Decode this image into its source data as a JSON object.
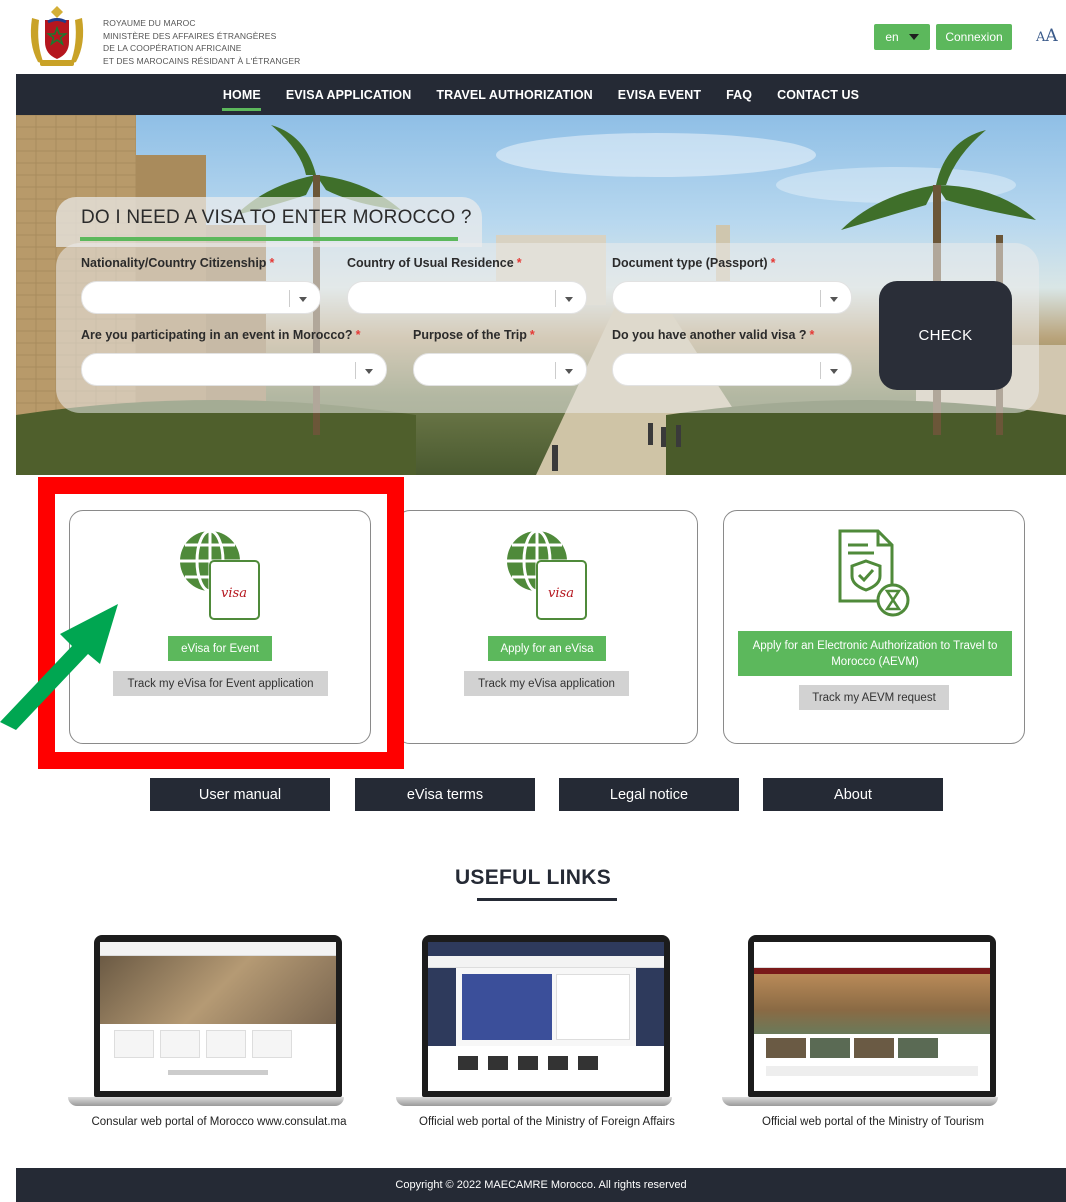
{
  "header": {
    "ministry_line1": "ROYAUME DU MAROC",
    "ministry_line2": "MINISTÈRE DES AFFAIRES ÉTRANGÈRES",
    "ministry_line3": "DE LA COOPÉRATION AFRICAINE",
    "ministry_line4": "ET DES MAROCAINS RÉSIDANT À L'ÉTRANGER",
    "language": "en",
    "login_label": "Connexion",
    "font_toggle_small": "A",
    "font_toggle_big": "A"
  },
  "nav": {
    "items": [
      "HOME",
      "EVISA APPLICATION",
      "TRAVEL AUTHORIZATION",
      "EVISA EVENT",
      "FAQ",
      "CONTACT US"
    ],
    "active": "HOME"
  },
  "visa_check": {
    "title": "DO I NEED A VISA TO ENTER MOROCCO ?",
    "required_mark": "*",
    "fields": [
      {
        "label": "Nationality/Country Citizenship",
        "value": ""
      },
      {
        "label": "Country of Usual Residence",
        "value": ""
      },
      {
        "label": "Document type (Passport)",
        "value": ""
      },
      {
        "label": "Are you participating in an event in Morocco?",
        "value": ""
      },
      {
        "label": "Purpose of the Trip",
        "value": ""
      },
      {
        "label": "Do you have another valid visa ?",
        "value": ""
      }
    ],
    "check_label": "CHECK"
  },
  "cards": [
    {
      "icon": "evisa-globe-icon",
      "primary_label": "eVisa for Event",
      "secondary_label": "Track my eVisa for Event application",
      "highlighted": true
    },
    {
      "icon": "evisa-globe-icon",
      "primary_label": "Apply for an eVisa",
      "secondary_label": "Track my eVisa application"
    },
    {
      "icon": "document-shield-hourglass-icon",
      "primary_label": "Apply for an Electronic Authorization to Travel to Morocco (AEVM)",
      "secondary_label": "Track my AEVM request"
    }
  ],
  "icon_text": "visa",
  "info_buttons": [
    "User manual",
    "eVisa terms",
    "Legal notice",
    "About"
  ],
  "useful_links": {
    "title": "USEFUL LINKS",
    "items": [
      {
        "caption": "Consular web portal of Morocco www.consulat.ma"
      },
      {
        "caption": "Official web portal of the Ministry of Foreign Affairs"
      },
      {
        "caption": "Official web portal of the Ministry of Tourism"
      }
    ]
  },
  "footer": {
    "copyright": "Copyright © 2022 MAECAMRE Morocco. All rights reserved"
  },
  "colors": {
    "brand_green": "#5cb85c",
    "dark_navy": "#252a35",
    "annotation_red": "#ff0000",
    "annotation_arrow_green": "#00a651"
  }
}
